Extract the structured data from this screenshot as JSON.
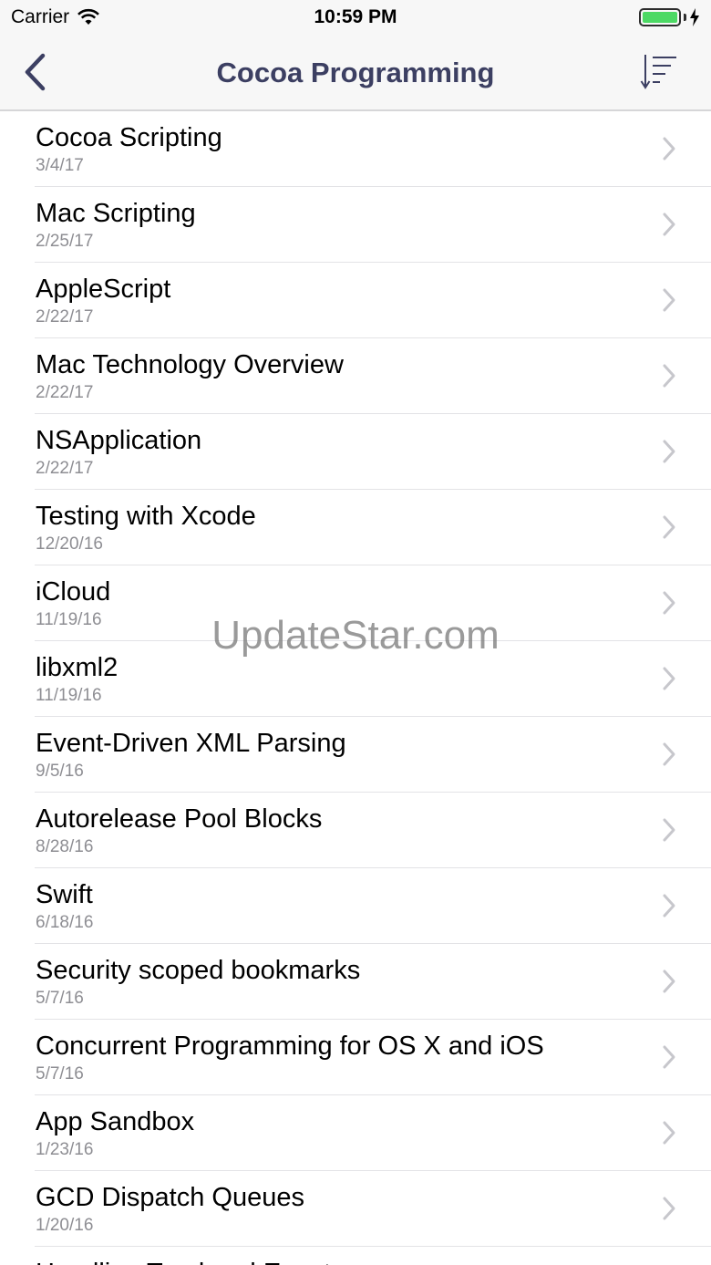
{
  "status_bar": {
    "carrier": "Carrier",
    "time": "10:59 PM",
    "battery_color": "#4cd964"
  },
  "nav": {
    "title": "Cocoa Programming",
    "back_icon": "chevron-left-icon",
    "sort_icon": "sort-descending-icon",
    "title_color": "#3c3f62"
  },
  "items": [
    {
      "title": "Cocoa Scripting",
      "date": "3/4/17"
    },
    {
      "title": "Mac Scripting",
      "date": "2/25/17"
    },
    {
      "title": "AppleScript",
      "date": "2/22/17"
    },
    {
      "title": "Mac Technology Overview",
      "date": "2/22/17"
    },
    {
      "title": "NSApplication",
      "date": "2/22/17"
    },
    {
      "title": "Testing with Xcode",
      "date": "12/20/16"
    },
    {
      "title": "iCloud",
      "date": "11/19/16"
    },
    {
      "title": "libxml2",
      "date": "11/19/16"
    },
    {
      "title": "Event-Driven XML Parsing",
      "date": "9/5/16"
    },
    {
      "title": "Autorelease Pool Blocks",
      "date": "8/28/16"
    },
    {
      "title": "Swift",
      "date": "6/18/16"
    },
    {
      "title": "Security scoped bookmarks",
      "date": "5/7/16"
    },
    {
      "title": "Concurrent Programming for OS X and iOS",
      "date": "5/7/16"
    },
    {
      "title": "App Sandbox",
      "date": "1/23/16"
    },
    {
      "title": "GCD Dispatch Queues",
      "date": "1/20/16"
    },
    {
      "title": "Handling Trackpad Events",
      "date": ""
    }
  ],
  "watermark": "UpdateStar.com"
}
